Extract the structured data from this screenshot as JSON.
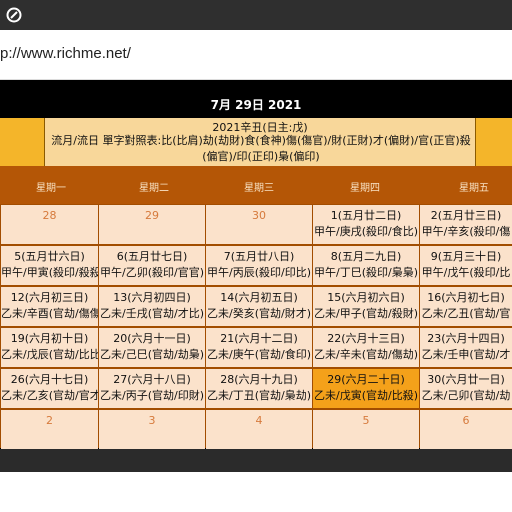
{
  "browser": {
    "url": "p://www.richme.net/"
  },
  "calendar": {
    "date_title": "7月  29日  2021",
    "header_title": "2021辛丑(日主:戊)",
    "legend": "流月/流日 單字對照表:比(比肩)劫(劫財)食(食神)傷(傷官)/財(正財)才(偏財)/官(正官)殺(偏官)/印(正印)梟(偏印)",
    "weekdays": [
      "星期一",
      "星期二",
      "星期三",
      "星期四",
      "星期五"
    ],
    "rows": [
      [
        {
          "num": "28"
        },
        {
          "num": "29"
        },
        {
          "num": "30"
        },
        {
          "l1": "1(五月廿二日)",
          "l2": "甲午/庚戌(殺印/食比)"
        },
        {
          "l1": "2(五月廿三日)",
          "l2": "甲午/辛亥(殺印/傷"
        }
      ],
      [
        {
          "l1": "5(五月廿六日)",
          "l2": "甲午/甲寅(殺印/殺殺)"
        },
        {
          "l1": "6(五月廿七日)",
          "l2": "甲午/乙卯(殺印/官官)"
        },
        {
          "l1": "7(五月廿八日)",
          "l2": "甲午/丙辰(殺印/印比)"
        },
        {
          "l1": "8(五月二九日)",
          "l2": "甲午/丁巳(殺印/梟梟)"
        },
        {
          "l1": "9(五月三十日)",
          "l2": "甲午/戊午(殺印/比"
        }
      ],
      [
        {
          "l1": "12(六月初三日)",
          "l2": "乙未/辛酉(官劫/傷傷)"
        },
        {
          "l1": "13(六月初四日)",
          "l2": "乙未/壬戌(官劫/才比)"
        },
        {
          "l1": "14(六月初五日)",
          "l2": "乙未/癸亥(官劫/財才)"
        },
        {
          "l1": "15(六月初六日)",
          "l2": "乙未/甲子(官劫/殺財)"
        },
        {
          "l1": "16(六月初七日)",
          "l2": "乙未/乙丑(官劫/官"
        }
      ],
      [
        {
          "l1": "19(六月初十日)",
          "l2": "乙未/戊辰(官劫/比比)"
        },
        {
          "l1": "20(六月十一日)",
          "l2": "乙未/己巳(官劫/劫梟)"
        },
        {
          "l1": "21(六月十二日)",
          "l2": "乙未/庚午(官劫/食印)"
        },
        {
          "l1": "22(六月十三日)",
          "l2": "乙未/辛未(官劫/傷劫)"
        },
        {
          "l1": "23(六月十四日)",
          "l2": "乙未/壬申(官劫/才"
        }
      ],
      [
        {
          "l1": "26(六月十七日)",
          "l2": "乙未/乙亥(官劫/官才)"
        },
        {
          "l1": "27(六月十八日)",
          "l2": "乙未/丙子(官劫/印財)"
        },
        {
          "l1": "28(六月十九日)",
          "l2": "乙未/丁丑(官劫/梟劫)"
        },
        {
          "l1": "29(六月二十日)",
          "l2": "乙未/戊寅(官劫/比殺)",
          "today": true
        },
        {
          "l1": "30(六月廿一日)",
          "l2": "乙未/己卯(官劫/劫"
        }
      ],
      [
        {
          "num": "2"
        },
        {
          "num": "3"
        },
        {
          "num": "4"
        },
        {
          "num": "5"
        },
        {
          "num": "6"
        }
      ]
    ]
  }
}
